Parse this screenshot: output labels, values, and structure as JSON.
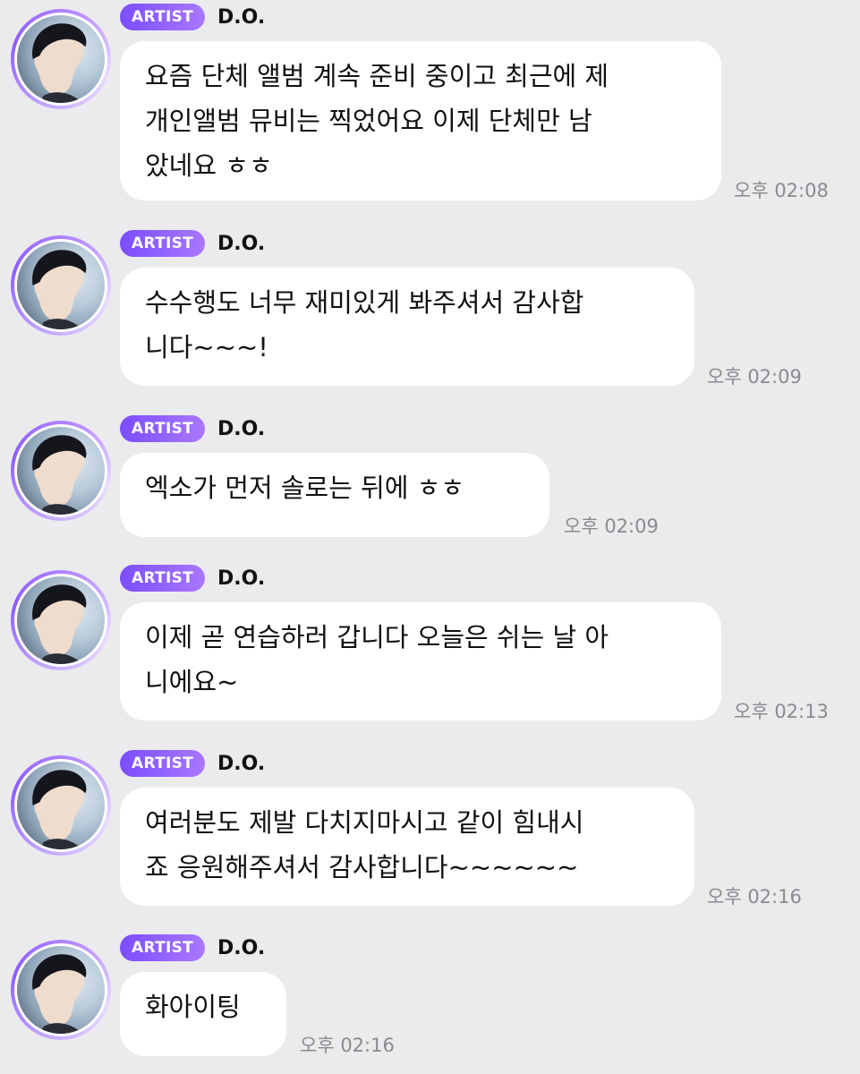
{
  "messages": [
    {
      "badge": "ARTIST",
      "name": "D.O.",
      "text": "요즘 단체 앨범 계속 준비 중이고 최근에 제\n개인앨범 뮤비는 찍었어요 이제 단체만 남\n았네요 ㅎㅎ",
      "time": "오후 02:08"
    },
    {
      "badge": "ARTIST",
      "name": "D.O.",
      "text": "수수행도 너무 재미있게 봐주셔서 감사합\n니다~~~!",
      "time": "오후 02:09"
    },
    {
      "badge": "ARTIST",
      "name": "D.O.",
      "text": "엑소가 먼저 솔로는 뒤에 ㅎㅎ",
      "time": "오후 02:09"
    },
    {
      "badge": "ARTIST",
      "name": "D.O.",
      "text": "이제 곧 연습하러 갑니다 오늘은 쉬는 날 아\n니에요~",
      "time": "오후 02:13"
    },
    {
      "badge": "ARTIST",
      "name": "D.O.",
      "text": "여러분도 제발 다치지마시고 같이 힘내시\n죠 응원해주셔서 감사합니다~~~~~~",
      "time": "오후 02:16"
    },
    {
      "badge": "ARTIST",
      "name": "D.O.",
      "text": "화아이팅",
      "time": "오후 02:16"
    }
  ]
}
